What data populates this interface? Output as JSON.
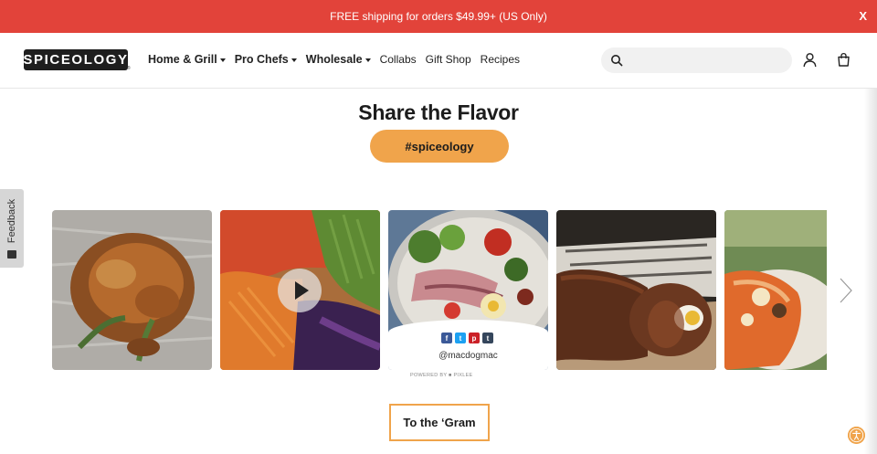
{
  "promo": {
    "text": "FREE shipping for orders $49.99+ (US Only)",
    "close_label": "X",
    "background": "#e2433a"
  },
  "header": {
    "logo_text": "SPICEOLOGY",
    "logo_tm": "®",
    "nav": [
      {
        "label": "Home & Grill",
        "bold": true,
        "dropdown": true
      },
      {
        "label": "Pro Chefs",
        "bold": true,
        "dropdown": true
      },
      {
        "label": "Wholesale",
        "bold": true,
        "dropdown": true
      },
      {
        "label": "Collabs",
        "bold": false,
        "dropdown": false
      },
      {
        "label": "Gift Shop",
        "bold": false,
        "dropdown": false
      },
      {
        "label": "Recipes",
        "bold": false,
        "dropdown": false
      }
    ],
    "search": {
      "value": "",
      "placeholder": "",
      "icon": "search-icon"
    },
    "account_icon": "account-icon",
    "cart_icon": "cart-icon"
  },
  "main": {
    "title": "Share the Flavor",
    "hashtag": "#spiceology",
    "accent": "#f0a44b"
  },
  "feedback": {
    "label": "Feedback"
  },
  "carousel": {
    "items": [
      {
        "type": "image",
        "subject": "roast-chicken"
      },
      {
        "type": "video",
        "subject": "vegetable-slaw",
        "play_icon": "play-icon"
      },
      {
        "type": "image",
        "subject": "salad-platter",
        "hover": true,
        "handle": "@macdogmac",
        "share": [
          "f",
          "t",
          "p",
          "t"
        ]
      },
      {
        "type": "image",
        "subject": "sliced-meatloaf"
      },
      {
        "type": "image",
        "subject": "loaded-dish"
      }
    ],
    "next_icon": "chevron-right-icon"
  },
  "powered_by": "POWERED BY ■ PIXLEE",
  "gram_button": "To the ‘Gram",
  "accessibility_icon": "accessibility-icon"
}
